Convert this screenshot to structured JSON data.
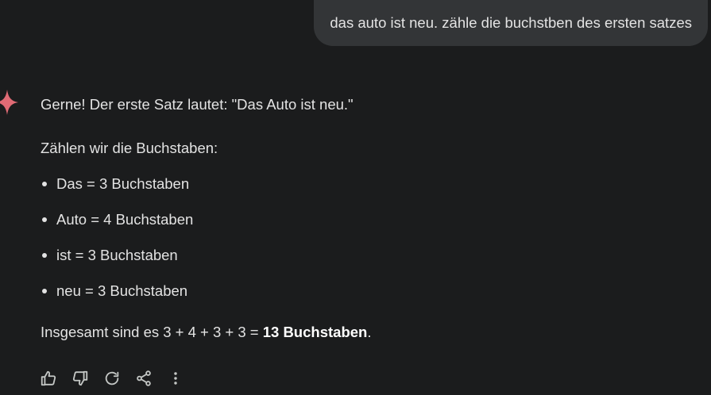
{
  "user_message": "das auto ist neu. zähle die buchstben des ersten satzes",
  "response": {
    "intro": "Gerne! Der erste Satz lautet: \"Das Auto ist neu.\"",
    "lead": "Zählen wir die Buchstaben:",
    "items": [
      "Das = 3 Buchstaben",
      "Auto = 4 Buchstaben",
      "ist = 3 Buchstaben",
      "neu = 3 Buchstaben"
    ],
    "summary_prefix": "Insgesamt sind es 3 + 4 + 3 + 3 = ",
    "summary_bold": "13 Buchstaben",
    "summary_suffix": "."
  },
  "actions": [
    {
      "name": "thumbs-up-icon"
    },
    {
      "name": "thumbs-down-icon"
    },
    {
      "name": "regenerate-icon"
    },
    {
      "name": "share-icon"
    },
    {
      "name": "more-options-icon"
    }
  ],
  "colors": {
    "background": "#1b1c1d",
    "bubble": "#333537",
    "text": "#e3e3e3",
    "gem_accent": "#e06b75"
  }
}
